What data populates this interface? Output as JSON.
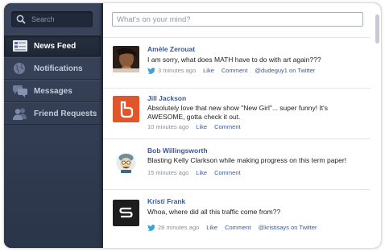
{
  "search": {
    "placeholder": "Search"
  },
  "sidebar": {
    "items": [
      {
        "label": "News Feed",
        "icon": "news-feed-icon",
        "active": true
      },
      {
        "label": "Notifications",
        "icon": "globe-icon",
        "active": false
      },
      {
        "label": "Messages",
        "icon": "messages-icon",
        "active": false
      },
      {
        "label": "Friend Requests",
        "icon": "friends-icon",
        "active": false
      }
    ]
  },
  "composer": {
    "placeholder": "What's on your mind?"
  },
  "posts": [
    {
      "name": "Amèle Zerouat",
      "text": "I am sorry, what does MATH have to do with art again???",
      "time": "3 minutes ago",
      "like": "Like",
      "comment": "Comment",
      "extra": "@dudeguy1 on Twitter",
      "via_twitter": true,
      "avatar": "photo"
    },
    {
      "name": "Jill Jackson",
      "text": "Absolutely love that new show \"New Girl\"... super funny! It's AWESOME, gotta check it out.",
      "time": "10 minutes ago",
      "like": "Like",
      "comment": "Comment",
      "via_twitter": false,
      "avatar": "app-logo"
    },
    {
      "name": "Bob Willingsworth",
      "text": "Blasting Kelly Clarkson while making progress on this term paper!",
      "time": "15 minutes ago",
      "like": "Like",
      "comment": "Comment",
      "via_twitter": false,
      "avatar": "character"
    },
    {
      "name": "Kristi Frank",
      "text": "Whoa, where did all this traffic come from??",
      "time": "28 minutes ago",
      "like": "Like",
      "comment": "Comment",
      "extra": "@kristisays on Twitter",
      "via_twitter": true,
      "avatar": "s-logo"
    }
  ],
  "colors": {
    "sidebar": "#2f3a51",
    "link": "#3b5998",
    "twitter": "#3ea2d6",
    "app_logo": "#e0552a"
  }
}
